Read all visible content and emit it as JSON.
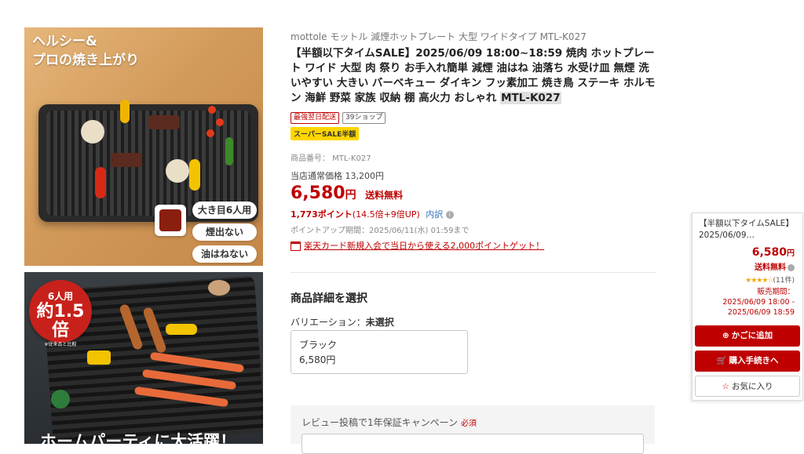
{
  "images": {
    "main_headline_1": "ヘルシー&",
    "main_headline_2": "プロの焼き上がり",
    "badges": [
      "大き目6人用",
      "煙出ない",
      "油はねない"
    ],
    "second_circle_top": "6人用",
    "second_circle_mid": "約1.5倍",
    "second_circle_note": "※従来品と比較",
    "second_bottom_text": "ホームパーティに大活躍！"
  },
  "product": {
    "brand_line": "mottole モットル 減煙ホットプレート 大型 ワイドタイプ MTL-K027",
    "title": "【半額以下タイムSALE】2025/06/09 18:00~18:59 焼肉 ホットプレート ワイド 大型 肉 祭り お手入れ簡単 減煙 油はね 油落ち 水受け皿 無煙 洗いやすい 大きい バーベキュー ダイキン フッ素加工 焼き鳥 ステーキ ホルモン 海鮮 野菜 家族 収納 棚 高火力 おしゃれ",
    "title_code": "MTL-K027",
    "tag_delivery": "最強翌日配送",
    "tag_shop": "39ショップ",
    "tag_super": "スーパーSALE半額",
    "item_number": "商品番号：  MTL-K027",
    "regular_price": "当店通常価格 13,200円",
    "price": "6,580",
    "yen": "円",
    "shipping": "送料無料",
    "points": "1,773ポイント",
    "points_rate": "(14.5倍+9倍UP)",
    "points_detail": "内訳",
    "points_period": "ポイントアップ期間：2025/06/11(水) 01:59まで",
    "card_promo": "楽天カード新規入会で当日から使える2,000ポイントゲット！"
  },
  "selection": {
    "heading": "商品詳細を選択",
    "variation_label": "バリエーション：",
    "variation_value": "未選択",
    "option_name": "ブラック",
    "option_price": "6,580円"
  },
  "review": {
    "label": "レビュー投稿で1年保証キャンペーン",
    "required": "必須"
  },
  "sidebar": {
    "title_line1": "【半額以下タイムSALE】",
    "title_line2": "2025/06/09…",
    "price": "6,580",
    "yen": "円",
    "shipping": "送料無料",
    "stars": "★★★★☆",
    "review_count": "(11件)",
    "sale_label": "販売期間：",
    "sale_start": "2025/06/09 18:00 -",
    "sale_end": "2025/06/09 18:59",
    "cart_button": "かごに追加",
    "buy_button": "購入手続きへ",
    "fav_button": "お気に入り"
  },
  "colors": {
    "accent": "#bf0000",
    "sale_yellow": "#ffd600",
    "link": "#2a6ebb"
  }
}
